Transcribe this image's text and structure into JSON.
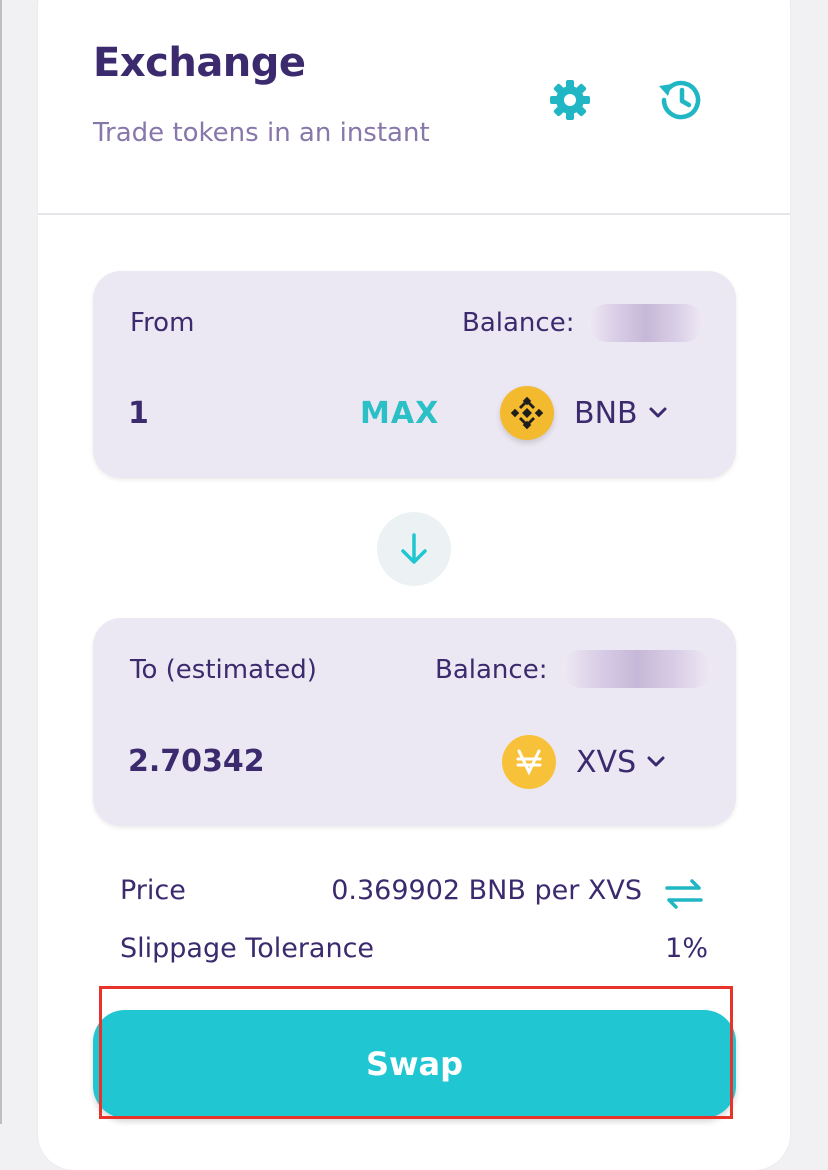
{
  "header": {
    "title": "Exchange",
    "subtitle": "Trade tokens in an instant",
    "settings_icon": "gear-icon",
    "history_icon": "history-icon"
  },
  "from_panel": {
    "label": "From",
    "balance_label": "Balance:",
    "amount": "1",
    "max_label": "MAX",
    "token": "BNB",
    "token_icon": "bnb-logo-icon"
  },
  "swap_direction_icon": "arrow-down-icon",
  "to_panel": {
    "label": "To (estimated)",
    "balance_label": "Balance:",
    "amount": "2.70342",
    "token": "XVS",
    "token_icon": "xvs-logo-icon"
  },
  "details": {
    "price_label": "Price",
    "price_value": "0.369902 BNB per XVS",
    "invert_icon": "swap-arrows-icon",
    "slippage_label": "Slippage Tolerance",
    "slippage_value": "1%"
  },
  "actions": {
    "swap_label": "Swap"
  },
  "colors": {
    "primary_text": "#3b2a6e",
    "accent": "#20c6d1",
    "panel_bg": "#ece8f3",
    "bnb_yellow": "#f3ba2f",
    "highlight": "#e8332a"
  }
}
